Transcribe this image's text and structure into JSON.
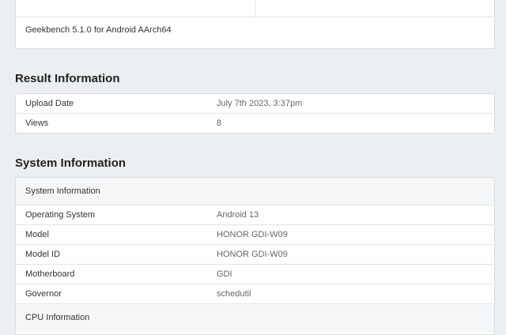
{
  "top_card": {
    "footer": "Geekbench 5.1.0 for Android AArch64"
  },
  "result_info": {
    "title": "Result Information",
    "rows": [
      {
        "label": "Upload Date",
        "value": "July 7th 2023, 3:37pm"
      },
      {
        "label": "Views",
        "value": "8"
      }
    ]
  },
  "system_info": {
    "title": "System Information",
    "table_header": "System Information",
    "rows": [
      {
        "label": "Operating System",
        "value": "Android 13"
      },
      {
        "label": "Model",
        "value": "HONOR GDI-W09"
      },
      {
        "label": "Model ID",
        "value": "HONOR GDI-W09"
      },
      {
        "label": "Motherboard",
        "value": "GDI"
      },
      {
        "label": "Governor",
        "value": "schedutil"
      }
    ],
    "next_header": "CPU Information"
  }
}
